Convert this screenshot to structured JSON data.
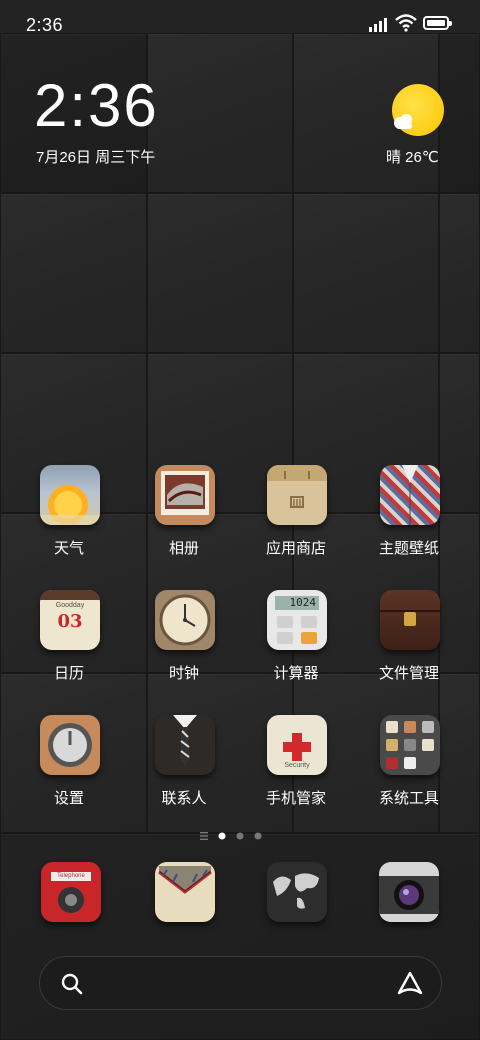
{
  "status_bar": {
    "time": "2:36",
    "icons": [
      "signal-icon",
      "wifi-icon",
      "battery-icon"
    ]
  },
  "widget": {
    "time": "2:36",
    "date": "7月26日 周三下午",
    "weather": "晴 26℃",
    "weather_icon": "sunny-cloud-icon"
  },
  "apps": [
    {
      "label": "天气",
      "icon": "weather-icon"
    },
    {
      "label": "相册",
      "icon": "gallery-icon"
    },
    {
      "label": "应用商店",
      "icon": "app-store-icon"
    },
    {
      "label": "主题壁纸",
      "icon": "themes-icon"
    },
    {
      "label": "日历",
      "icon": "calendar-icon",
      "badge_top": "Goodday",
      "badge_day": "03"
    },
    {
      "label": "时钟",
      "icon": "clock-icon"
    },
    {
      "label": "计算器",
      "icon": "calculator-icon",
      "display": "1024"
    },
    {
      "label": "文件管理",
      "icon": "file-manager-icon"
    },
    {
      "label": "设置",
      "icon": "settings-icon"
    },
    {
      "label": "联系人",
      "icon": "contacts-icon"
    },
    {
      "label": "手机管家",
      "icon": "security-icon",
      "caption": "Security"
    },
    {
      "label": "系统工具",
      "icon": "tools-folder-icon"
    }
  ],
  "page_indicator": {
    "pages": 3,
    "current": 1
  },
  "dock": [
    {
      "icon": "phone-icon",
      "caption": "Telephone"
    },
    {
      "icon": "messages-icon"
    },
    {
      "icon": "browser-icon"
    },
    {
      "icon": "camera-icon"
    }
  ],
  "search_bar": {
    "icons": [
      "search-icon",
      "assistant-icon"
    ]
  },
  "colors": {
    "sun": "#ffc400",
    "wallpaper": "#262626"
  }
}
